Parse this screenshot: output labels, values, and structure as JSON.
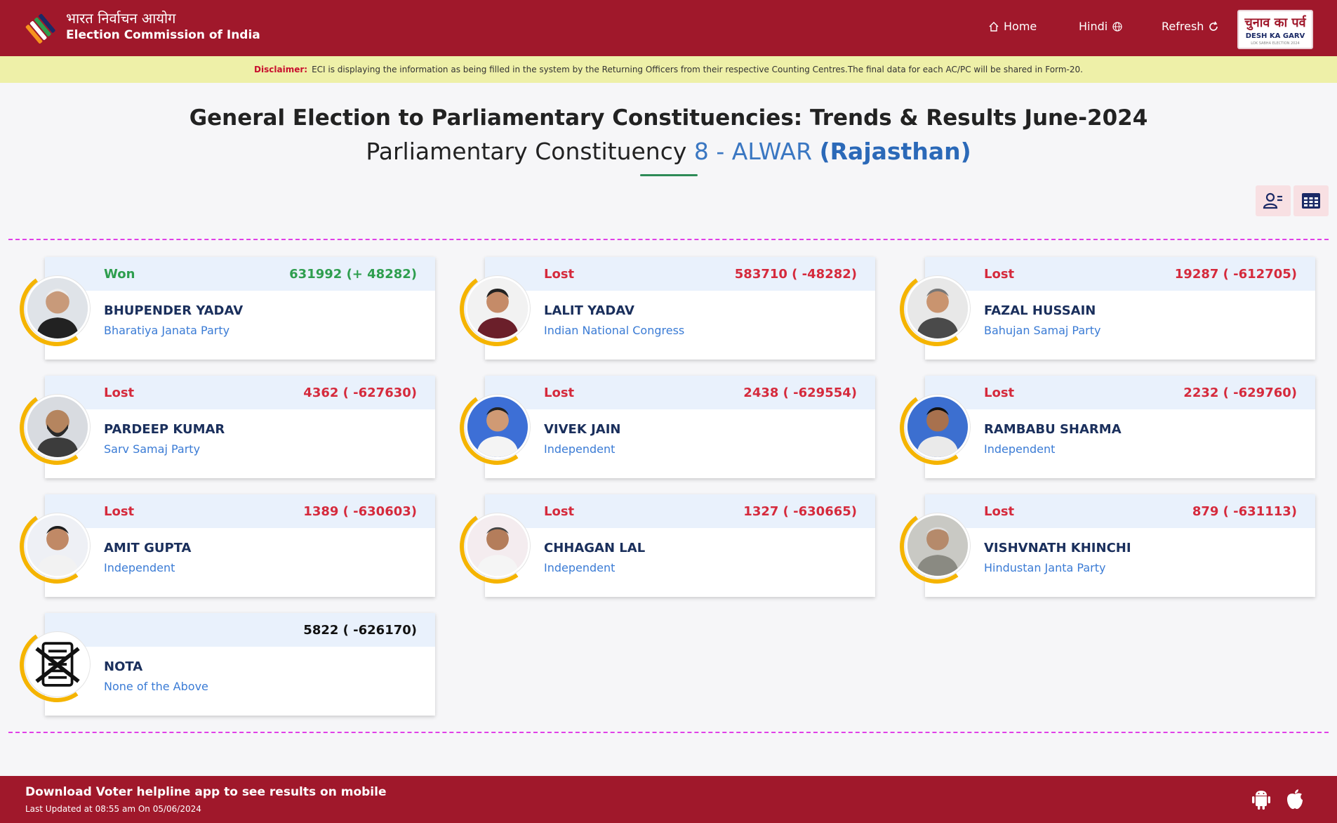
{
  "header": {
    "brand_hindi": "भारत निर्वाचन आयोग",
    "brand_english": "Election Commission of India",
    "nav_home": "Home",
    "nav_hindi": "Hindi",
    "nav_refresh": "Refresh",
    "badge_hindi": "चुनाव का पर्व",
    "badge_english": "DESH KA GARV",
    "badge_small": "LOK SABHA ELECTION 2024"
  },
  "disclaimer": {
    "label": "Disclaimer:",
    "text": "ECI is displaying the information as being filled in the system by the Returning Officers from their respective Counting Centres.The final data for each AC/PC will be shared in Form-20."
  },
  "page": {
    "title": "General Election to Parliamentary Constituencies: Trends & Results June-2024",
    "subtitle_prefix": "Parliamentary Constituency",
    "constituency": "8 - ALWAR",
    "state": "(Rajasthan)"
  },
  "candidates": [
    {
      "status": "Won",
      "votes": "631992 (+ 48282)",
      "name": "BHUPENDER YADAV",
      "party": "Bharatiya Janata Party"
    },
    {
      "status": "Lost",
      "votes": "583710 ( -48282)",
      "name": "LALIT YADAV",
      "party": "Indian National Congress"
    },
    {
      "status": "Lost",
      "votes": "19287 ( -612705)",
      "name": "FAZAL HUSSAIN",
      "party": "Bahujan Samaj Party"
    },
    {
      "status": "Lost",
      "votes": "4362 ( -627630)",
      "name": "PARDEEP KUMAR",
      "party": "Sarv Samaj Party"
    },
    {
      "status": "Lost",
      "votes": "2438 ( -629554)",
      "name": "VIVEK JAIN",
      "party": "Independent"
    },
    {
      "status": "Lost",
      "votes": "2232 ( -629760)",
      "name": "RAMBABU SHARMA",
      "party": "Independent"
    },
    {
      "status": "Lost",
      "votes": "1389 ( -630603)",
      "name": "AMIT GUPTA",
      "party": "Independent"
    },
    {
      "status": "Lost",
      "votes": "1327 ( -630665)",
      "name": "CHHAGAN LAL",
      "party": "Independent"
    },
    {
      "status": "Lost",
      "votes": "879 ( -631113)",
      "name": "VISHVNATH KHINCHI",
      "party": "Hindustan Janta Party"
    },
    {
      "status": "",
      "votes": "5822 ( -626170)",
      "name": "NOTA",
      "party": "None of the Above"
    }
  ],
  "footer": {
    "download_text": "Download Voter helpline app to see results on mobile",
    "last_updated": "Last Updated at 08:55 am On 05/06/2024"
  }
}
